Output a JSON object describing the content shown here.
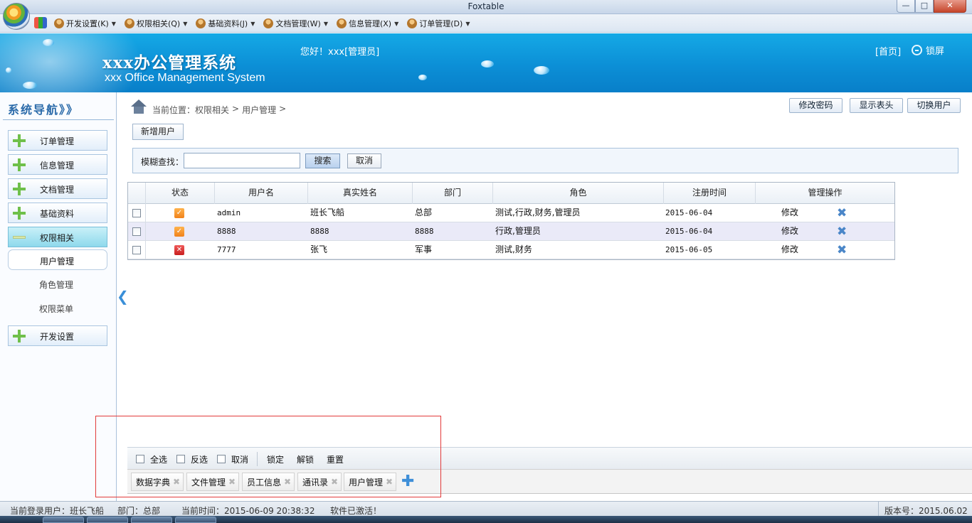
{
  "window": {
    "title": "Foxtable"
  },
  "menubar": {
    "items": [
      {
        "label": "开发设置(K)"
      },
      {
        "label": "权限相关(Q)"
      },
      {
        "label": "基础资料(J)"
      },
      {
        "label": "文档管理(W)"
      },
      {
        "label": "信息管理(X)"
      },
      {
        "label": "订单管理(D)"
      }
    ]
  },
  "banner": {
    "title": "xxx办公管理系统",
    "subtitle": "xxx Office Management System",
    "greeting": "您好！xxx[管理员]",
    "home": "[首页]",
    "lock": "锁屏"
  },
  "sidebar": {
    "title": "系统导航》》",
    "items": [
      {
        "label": "订单管理"
      },
      {
        "label": "信息管理"
      },
      {
        "label": "文档管理"
      },
      {
        "label": "基础资料"
      },
      {
        "label": "权限相关"
      },
      {
        "label": "开发设置"
      }
    ],
    "subitems": [
      {
        "label": "用户管理"
      },
      {
        "label": "角色管理"
      },
      {
        "label": "权限菜单"
      }
    ]
  },
  "main": {
    "breadcrumb": {
      "prefix": "当前位置：权限相关",
      "sep": ">",
      "current": "用户管理",
      "tail": ">"
    },
    "buttons": {
      "change_pwd": "修改密码",
      "show_header": "显示表头",
      "switch_user": "切换用户",
      "add_user": "新增用户"
    },
    "search": {
      "label": "模糊查找：",
      "value": "",
      "search": "搜索",
      "cancel": "取消"
    }
  },
  "grid": {
    "columns": [
      "状态",
      "用户名",
      "真实姓名",
      "部门",
      "角色",
      "注册时间",
      "管理操作"
    ],
    "rows": [
      {
        "status": "ok",
        "username": "admin",
        "realname": "班长飞船",
        "dept": "总部",
        "roles": "测试,行政,财务,管理员",
        "date": "2015-06-04",
        "action": "修改"
      },
      {
        "status": "ok",
        "username": "8888",
        "realname": "8888",
        "dept": "8888",
        "roles": "行政,管理员",
        "date": "2015-06-04",
        "action": "修改"
      },
      {
        "status": "bad",
        "username": "7777",
        "realname": "张飞",
        "dept": "军事",
        "roles": "测试,财务",
        "date": "2015-06-05",
        "action": "修改"
      }
    ]
  },
  "bottom_toolbar": {
    "select_all": "全选",
    "invert": "反选",
    "cancel": "取消",
    "lock": "锁定",
    "unlock": "解锁",
    "reset": "重置"
  },
  "tabs": [
    {
      "label": "数据字典"
    },
    {
      "label": "文件管理"
    },
    {
      "label": "员工信息"
    },
    {
      "label": "通讯录"
    },
    {
      "label": "用户管理"
    }
  ],
  "statusbar": {
    "user": "当前登录用户：班长飞船",
    "dept": "部门：总部",
    "time": "当前时间：2015-06-09 20:38:32",
    "activation": "软件已激活！",
    "version": "版本号：2015.06.02"
  }
}
